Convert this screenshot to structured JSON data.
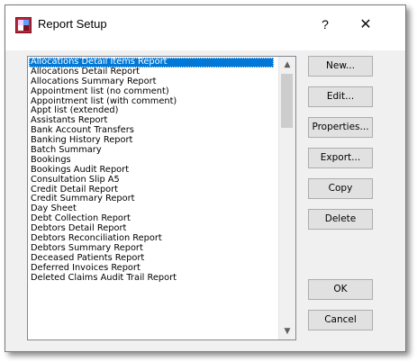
{
  "window": {
    "title": "Report Setup",
    "help_label": "?",
    "close_label": "✕"
  },
  "reports": [
    "Allocations Detail Items Report",
    "Allocations Detail Report",
    "Allocations Summary Report",
    "Appointment list (no comment)",
    "Appointment list (with comment)",
    "Appt list (extended)",
    "Assistants Report",
    "Bank Account Transfers",
    "Banking History Report",
    "Batch Summary",
    "Bookings",
    "Bookings Audit Report",
    "Consultation Slip A5",
    "Credit Detail Report",
    "Credit Summary Report",
    "Day Sheet",
    "Debt Collection Report",
    "Debtors Detail Report",
    "Debtors Reconciliation Report",
    "Debtors Summary Report",
    "Deceased Patients Report",
    "Deferred Invoices Report",
    "Deleted Claims Audit Trail Report"
  ],
  "selected_index": 0,
  "buttons": {
    "new": "New...",
    "edit": "Edit...",
    "properties": "Properties...",
    "export": "Export...",
    "copy": "Copy",
    "delete": "Delete",
    "ok": "OK",
    "cancel": "Cancel"
  },
  "scrollbar": {
    "up_glyph": "▲",
    "down_glyph": "▼"
  },
  "colors": {
    "selection": "#0078d7",
    "dialog_bg": "#f0f0f0",
    "button_bg": "#e1e1e1"
  }
}
